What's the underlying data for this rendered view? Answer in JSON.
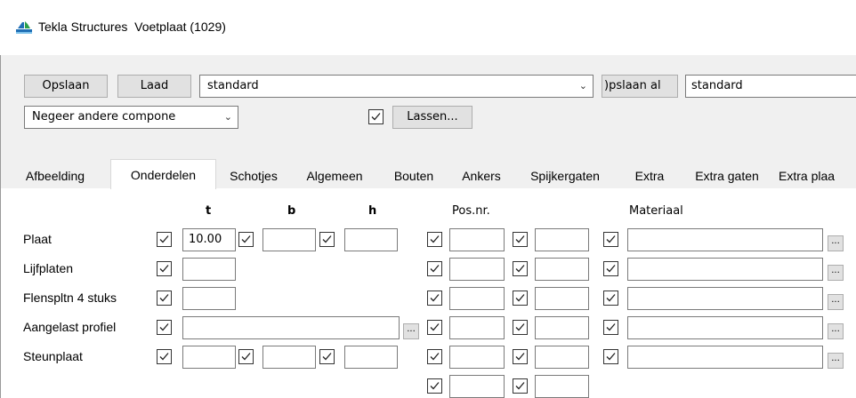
{
  "window": {
    "app_name": "Tekla Structures",
    "title": "Voetplaat (1029)"
  },
  "toolbar": {
    "save_label": "Opslaan",
    "load_label": "Laad",
    "preset_value": "standard",
    "save_as_label": ")pslaan al",
    "save_as_name": "standard",
    "ignore_combo_value": "Negeer andere compone",
    "welds_label": "Lassen..."
  },
  "tabs": [
    {
      "label": "Afbeelding"
    },
    {
      "label": "Onderdelen"
    },
    {
      "label": "Schotjes"
    },
    {
      "label": "Algemeen"
    },
    {
      "label": "Bouten"
    },
    {
      "label": "Ankers"
    },
    {
      "label": "Spijkergaten"
    },
    {
      "label": "Extra"
    },
    {
      "label": "Extra gaten"
    },
    {
      "label": "Extra plaa"
    }
  ],
  "selected_tab": "Onderdelen",
  "columns": {
    "t": "t",
    "b": "b",
    "h": "h",
    "pos": "Pos.nr.",
    "material": "Materiaal"
  },
  "rows": [
    {
      "label": "Plaat",
      "t": "10.00",
      "b": "",
      "h": "",
      "pos_prefix": "",
      "pos_start": "",
      "material": ""
    },
    {
      "label": "Lijfplaten",
      "t": "",
      "pos_prefix": "",
      "pos_start": "",
      "material": ""
    },
    {
      "label": "Flenspltn 4 stuks",
      "t": "",
      "pos_prefix": "",
      "pos_start": "",
      "material": ""
    },
    {
      "label": "Aangelast profiel",
      "profile": "",
      "pos_prefix": "",
      "pos_start": "",
      "material": ""
    },
    {
      "label": "Steunplaat",
      "t": "",
      "b": "",
      "h": "",
      "pos_prefix": "",
      "pos_start": "",
      "material": ""
    }
  ],
  "ellipsis": "...",
  "dropdown_arrow": "chevron-down-icon"
}
